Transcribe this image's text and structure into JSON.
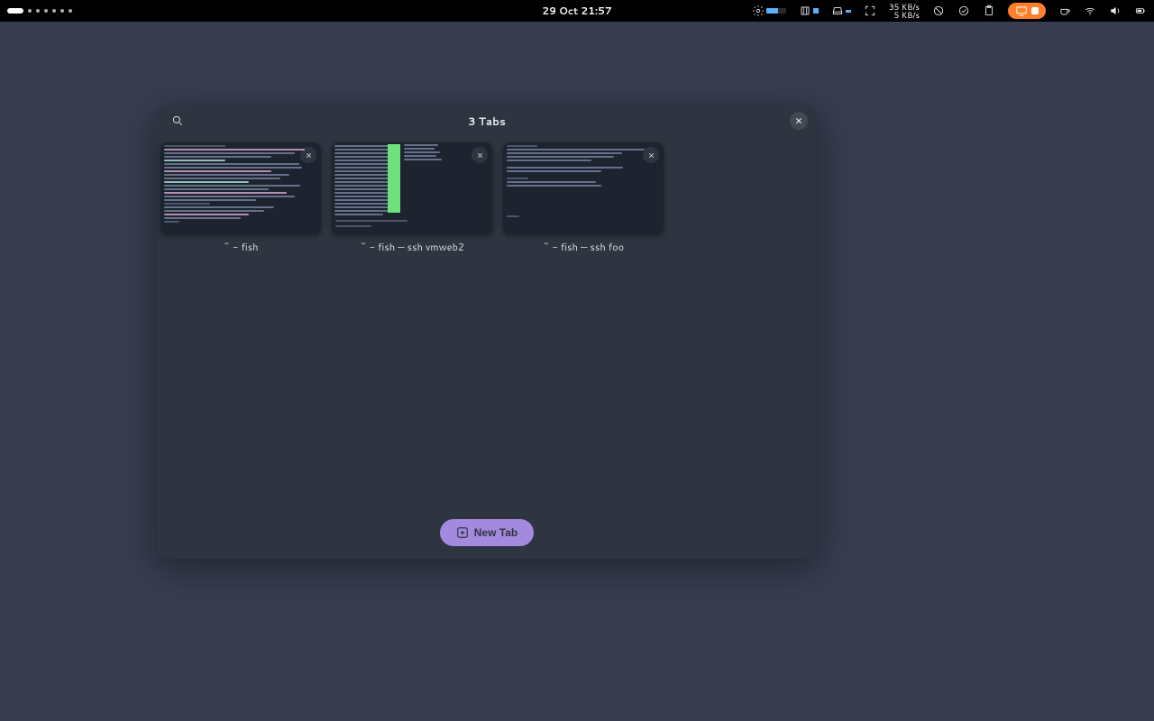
{
  "topbar": {
    "clock": "29 Oct  21:57",
    "net_speed_up": "35 KB/s",
    "net_speed_down": "5 KB/s"
  },
  "overview": {
    "title": "3 Tabs",
    "new_tab_label": "New Tab",
    "tabs": [
      {
        "label": "~ - fish"
      },
      {
        "label": "~ - fish — ssh vmweb2"
      },
      {
        "label": "~ - fish — ssh foo"
      }
    ]
  }
}
